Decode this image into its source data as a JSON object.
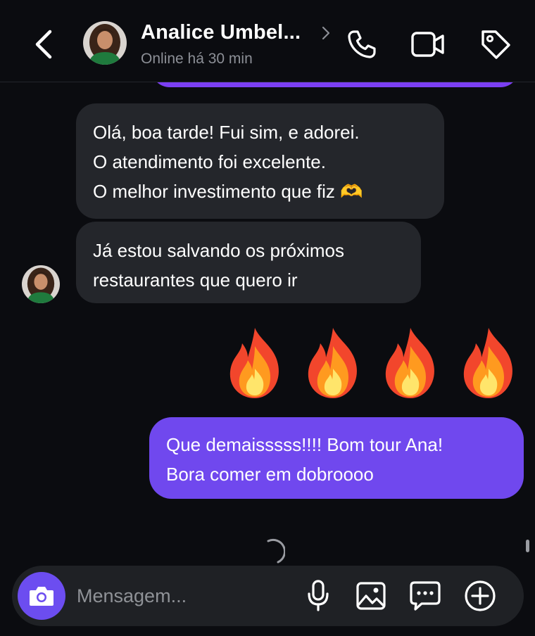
{
  "header": {
    "contact_name": "Analice Umbel...",
    "status": "Online há 30 min",
    "icons": [
      "back-chevron-icon",
      "chevron-right-icon",
      "phone-icon",
      "video-icon",
      "tag-icon"
    ]
  },
  "messages": [
    {
      "direction": "incoming",
      "text": "Olá, boa tarde! Fui sim, e adorei.\nO atendimento foi excelente.\nO melhor investimento que fiz 🫶"
    },
    {
      "direction": "incoming",
      "text": "Já estou salvando os próximos\nrestaurantes que quero ir"
    },
    {
      "direction": "outgoing",
      "text": "🔥🔥🔥🔥",
      "icons": [
        "fire-emoji",
        "fire-emoji",
        "fire-emoji",
        "fire-emoji"
      ]
    },
    {
      "direction": "outgoing",
      "text": "Que demaisssss!!!! Bom tour Ana!\nBora comer em dobroooo"
    }
  ],
  "composer": {
    "placeholder": "Mensagem...",
    "icons": [
      "camera-icon",
      "microphone-icon",
      "image-icon",
      "sticker-chat-icon",
      "plus-icon"
    ]
  },
  "colors": {
    "background": "#0b0c10",
    "incoming_bubble": "#24262b",
    "outgoing_bubble": "#7048ee",
    "accent": "#6c4df0",
    "muted_text": "#8c8f96"
  }
}
